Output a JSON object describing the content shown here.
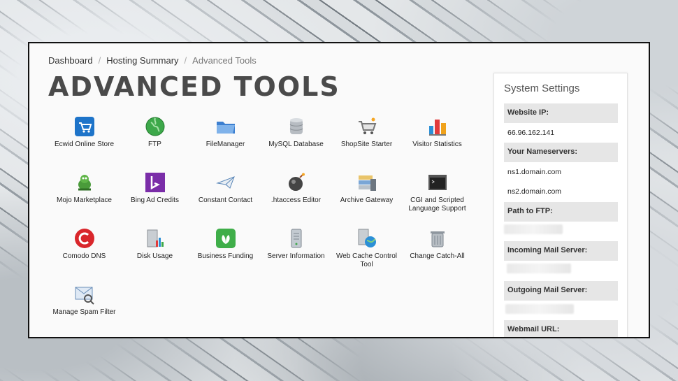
{
  "breadcrumb": [
    "Dashboard",
    "Hosting Summary",
    "Advanced Tools"
  ],
  "page_title": "ADVANCED TOOLS",
  "tools": [
    {
      "label": "Ecwid Online Store",
      "icon": "shopping-cart-icon"
    },
    {
      "label": "FTP",
      "icon": "globe-icon"
    },
    {
      "label": "FileManager",
      "icon": "folder-icon"
    },
    {
      "label": "MySQL Database",
      "icon": "database-icon"
    },
    {
      "label": "ShopSite Starter",
      "icon": "cart-icon"
    },
    {
      "label": "Visitor Statistics",
      "icon": "bar-chart-icon"
    },
    {
      "label": "Mojo Marketplace",
      "icon": "mojo-mascot-icon"
    },
    {
      "label": "Bing Ad Credits",
      "icon": "bing-icon"
    },
    {
      "label": "Constant Contact",
      "icon": "paper-plane-icon"
    },
    {
      "label": ".htaccess Editor",
      "icon": "bomb-icon"
    },
    {
      "label": "Archive Gateway",
      "icon": "archive-icon"
    },
    {
      "label": "CGI and Scripted Language Support",
      "icon": "terminal-icon"
    },
    {
      "label": "Comodo DNS",
      "icon": "comodo-icon"
    },
    {
      "label": "Disk Usage",
      "icon": "disk-usage-icon"
    },
    {
      "label": "Business Funding",
      "icon": "leaf-icon"
    },
    {
      "label": "Server Information",
      "icon": "server-icon"
    },
    {
      "label": "Web Cache Control Tool",
      "icon": "web-cache-icon"
    },
    {
      "label": "Change Catch-All",
      "icon": "trash-can-icon"
    },
    {
      "label": "Manage Spam Filter",
      "icon": "spam-filter-icon"
    }
  ],
  "sidebar": {
    "title": "System Settings",
    "website_ip_label": "Website IP:",
    "website_ip": "66.96.162.141",
    "nameservers_label": "Your Nameservers:",
    "ns1": "ns1.domain.com",
    "ns2": "ns2.domain.com",
    "ftp_path_label": "Path to FTP:",
    "incoming_label": "Incoming Mail Server:",
    "outgoing_label": "Outgoing Mail Server:",
    "webmail_label": "Webmail URL:"
  }
}
